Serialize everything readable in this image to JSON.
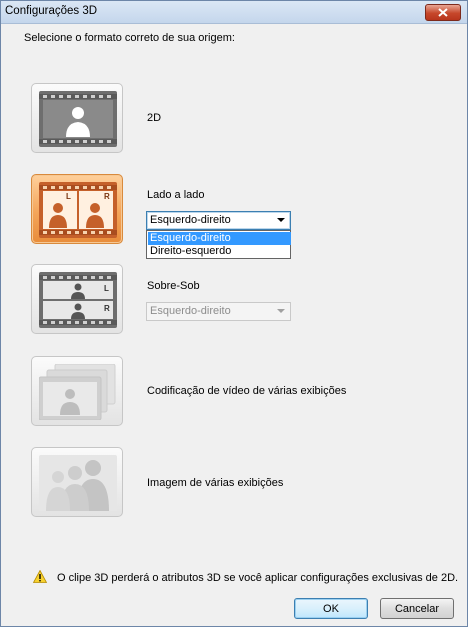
{
  "window": {
    "title": "Configurações 3D"
  },
  "instruction": "Selecione o formato correto de sua origem:",
  "options": {
    "opt_2d": {
      "label": "2D"
    },
    "side_by_side": {
      "label": "Lado a lado",
      "dropdown_value": "Esquerdo-direito",
      "dropdown_options": [
        "Esquerdo-direito",
        "Direito-esquerdo"
      ],
      "icon_letters": [
        "L",
        "R"
      ]
    },
    "top_bottom": {
      "label": "Sobre-Sob",
      "dropdown_value": "Esquerdo-direito",
      "icon_letters": [
        "L",
        "R"
      ]
    },
    "multiview_codec": {
      "label": "Codificação de vídeo de várias exibições"
    },
    "multiview_image": {
      "label": "Imagem de várias exibições"
    }
  },
  "warning": "O clipe 3D perderá o atributos 3D se você aplicar configurações exclusivas de 2D.",
  "buttons": {
    "ok": "OK",
    "cancel": "Cancelar"
  },
  "colors": {
    "selected_accent": "#f4a55a",
    "highlight": "#3399ff",
    "close": "#c6472b"
  }
}
